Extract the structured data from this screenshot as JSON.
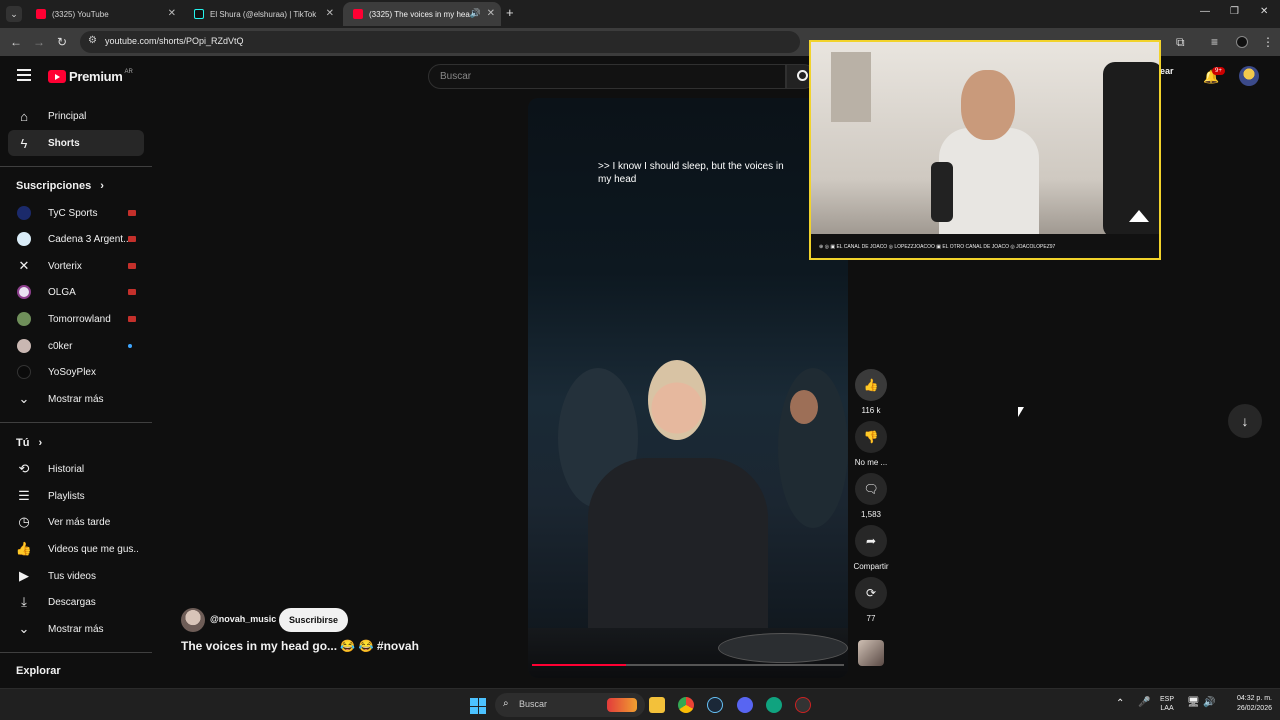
{
  "browser": {
    "tabs": [
      {
        "label": "(3325) YouTube"
      },
      {
        "label": "El Shura (@elshuraa) | TikTok"
      },
      {
        "label": "(3325) The voices in my hea"
      }
    ],
    "url": "youtube.com/shorts/POpi_RZdVtQ"
  },
  "youtube": {
    "logo": "Premium",
    "logo_region": "AR",
    "search_placeholder": "Buscar",
    "create_label": "Crear",
    "notif_count": "9+"
  },
  "sidebar": {
    "main": [
      {
        "label": "Principal",
        "icon": "home-icon"
      },
      {
        "label": "Shorts",
        "icon": "shorts-icon"
      }
    ],
    "subs_title": "Suscripciones",
    "subs": [
      {
        "label": "TyC Sports",
        "color": "#1b2a6b",
        "live": true
      },
      {
        "label": "Cadena 3 Argent...",
        "color": "#d9ecf7",
        "live": true
      },
      {
        "label": "Vorterix",
        "color": "#0f0f0f",
        "live": true
      },
      {
        "label": "OLGA",
        "color": "#e9e3f1",
        "live": true
      },
      {
        "label": "Tomorrowland",
        "color": "#6f8f5a",
        "live": true
      },
      {
        "label": "c0ker",
        "color": "#c9b7b2",
        "live": false
      },
      {
        "label": "YoSoyPlex",
        "color": "#0b0b0b",
        "live": false
      },
      {
        "label": "Mostrar más",
        "color": "",
        "live": false
      }
    ],
    "you_title": "Tú",
    "you": [
      {
        "label": "Historial",
        "icon": "history-icon"
      },
      {
        "label": "Playlists",
        "icon": "playlists-icon"
      },
      {
        "label": "Ver más tarde",
        "icon": "watch-later-icon"
      },
      {
        "label": "Videos que me gus...",
        "icon": "liked-videos-icon"
      },
      {
        "label": "Tus videos",
        "icon": "your-videos-icon"
      },
      {
        "label": "Descargas",
        "icon": "downloads-icon"
      },
      {
        "label": "Mostrar más",
        "icon": "chevron-down-icon"
      }
    ],
    "explore_title": "Explorar"
  },
  "short": {
    "caption": ">> I know I should sleep, but the voices in my head",
    "channel": "@novah_music",
    "subscribe": "Suscribirse",
    "title": "The voices in my head go... 😂 😂 #novah",
    "likes": "116 k",
    "dislike": "No me ...",
    "comments": "1,583",
    "share": "Compartir",
    "remix": "77"
  },
  "overlay": {
    "handles": "⊕ ◎ ▣  EL CANAL DE JOACO    ◎ LOPEZZJOACOO    ▣ EL OTRO CANAL DE JOACO    ◎ JOACOLOPEZ97"
  },
  "taskbar": {
    "search": "Buscar",
    "lang": "ESP",
    "lang2": "LAA",
    "time": "04:32 p. m.",
    "date": "26/02/2026"
  }
}
